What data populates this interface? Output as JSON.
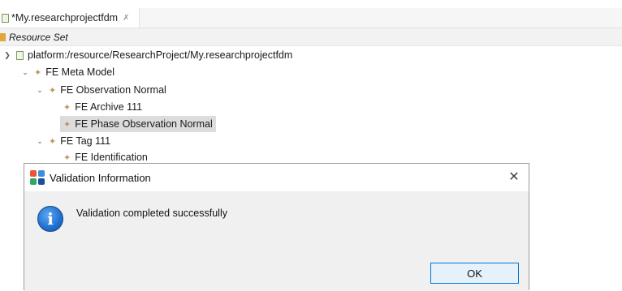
{
  "editor": {
    "tab_title": "*My.researchprojectfdm",
    "tab_close_glyph": "✗",
    "resource_set_label": "Resource Set"
  },
  "tree": {
    "platform_item": "platform:/resource/ResearchProject/My.researchprojectfdm",
    "items": [
      {
        "label": "FE Meta Model"
      },
      {
        "label": "FE Observation Normal"
      },
      {
        "label": "FE Archive 111"
      },
      {
        "label": "FE Phase Observation Normal"
      },
      {
        "label": "FE Tag 111"
      },
      {
        "label": "FE Identification"
      }
    ],
    "selected_item": "FE Phase Observation Normal"
  },
  "dialog": {
    "title": "Validation Information",
    "message": "Validation completed successfully",
    "ok_label": "OK",
    "info_glyph": "i",
    "close_glyph": "✕"
  },
  "colors": {
    "accent": "#0078d7",
    "info_blue": "#1f6fcf",
    "tree_icon": "#b89a5a",
    "selection": "#dcdcdc"
  },
  "icons": {
    "file": "file-icon",
    "folder": "folder-icon",
    "tree_node": "tree-node-icon",
    "info": "info-icon",
    "app": "app-logo-icon",
    "close": "close-icon"
  }
}
